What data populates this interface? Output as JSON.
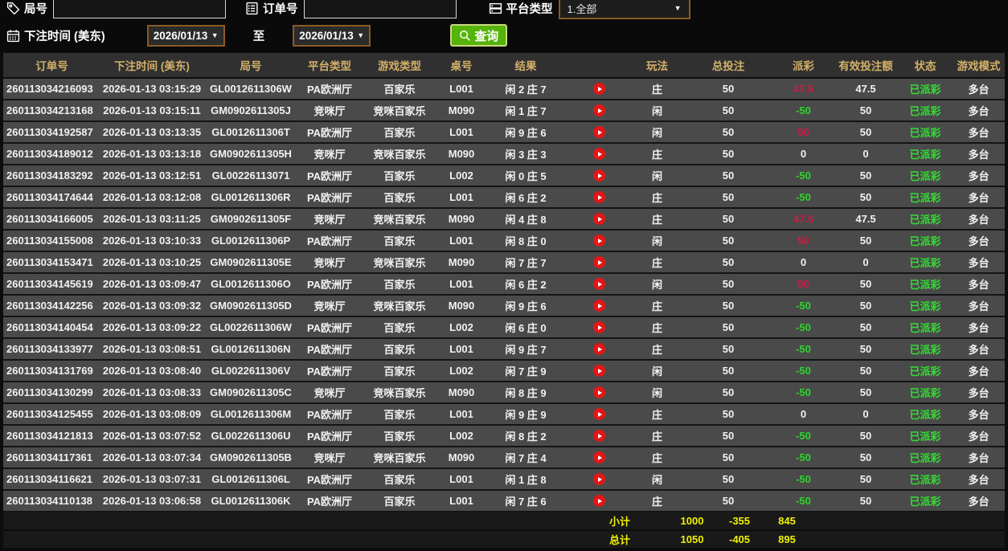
{
  "filters": {
    "game_no_label": "局号",
    "order_no_label": "订单号",
    "platform_label": "平台类型",
    "platform_value": "1.全部",
    "time_label": "下注时间 (美东)",
    "date_from": "2026/01/13",
    "date_to": "2026/01/13",
    "to_label": "至",
    "search_label": "查询"
  },
  "table": {
    "headers": [
      "订单号",
      "下注时间 (美东)",
      "局号",
      "平台类型",
      "游戏类型",
      "桌号",
      "结果",
      "玩法",
      "总投注",
      "派彩",
      "有效投注额",
      "状态",
      "游戏模式"
    ],
    "rows": [
      {
        "order": "260113034216093",
        "time": "2026-01-13 03:15:29",
        "game_no": "GL0012611306W",
        "platform": "PA欧洲厅",
        "game_type": "百家乐",
        "table_no": "L001",
        "result": "闲 2 庄 7",
        "bet": "庄",
        "total": "50",
        "payout": "47.5",
        "payout_class": "pos",
        "valid": "47.5",
        "status": "已派彩",
        "mode": "多台"
      },
      {
        "order": "260113034213168",
        "time": "2026-01-13 03:15:11",
        "game_no": "GM0902611305J",
        "platform": "竞咪厅",
        "game_type": "竞咪百家乐",
        "table_no": "M090",
        "result": "闲 1 庄 7",
        "bet": "闲",
        "total": "50",
        "payout": "-50",
        "payout_class": "neg",
        "valid": "50",
        "status": "已派彩",
        "mode": "多台"
      },
      {
        "order": "260113034192587",
        "time": "2026-01-13 03:13:35",
        "game_no": "GL0012611306T",
        "platform": "PA欧洲厅",
        "game_type": "百家乐",
        "table_no": "L001",
        "result": "闲 9 庄 6",
        "bet": "闲",
        "total": "50",
        "payout": "50",
        "payout_class": "pos",
        "valid": "50",
        "status": "已派彩",
        "mode": "多台"
      },
      {
        "order": "260113034189012",
        "time": "2026-01-13 03:13:18",
        "game_no": "GM0902611305H",
        "platform": "竞咪厅",
        "game_type": "竞咪百家乐",
        "table_no": "M090",
        "result": "闲 3 庄 3",
        "bet": "庄",
        "total": "50",
        "payout": "0",
        "payout_class": "zero",
        "valid": "0",
        "status": "已派彩",
        "mode": "多台"
      },
      {
        "order": "260113034183292",
        "time": "2026-01-13 03:12:51",
        "game_no": "GL00226113071",
        "platform": "PA欧洲厅",
        "game_type": "百家乐",
        "table_no": "L002",
        "result": "闲 0 庄 5",
        "bet": "闲",
        "total": "50",
        "payout": "-50",
        "payout_class": "neg",
        "valid": "50",
        "status": "已派彩",
        "mode": "多台"
      },
      {
        "order": "260113034174644",
        "time": "2026-01-13 03:12:08",
        "game_no": "GL0012611306R",
        "platform": "PA欧洲厅",
        "game_type": "百家乐",
        "table_no": "L001",
        "result": "闲 6 庄 2",
        "bet": "庄",
        "total": "50",
        "payout": "-50",
        "payout_class": "neg",
        "valid": "50",
        "status": "已派彩",
        "mode": "多台"
      },
      {
        "order": "260113034166005",
        "time": "2026-01-13 03:11:25",
        "game_no": "GM0902611305F",
        "platform": "竞咪厅",
        "game_type": "竞咪百家乐",
        "table_no": "M090",
        "result": "闲 4 庄 8",
        "bet": "庄",
        "total": "50",
        "payout": "47.5",
        "payout_class": "pos",
        "valid": "47.5",
        "status": "已派彩",
        "mode": "多台"
      },
      {
        "order": "260113034155008",
        "time": "2026-01-13 03:10:33",
        "game_no": "GL0012611306P",
        "platform": "PA欧洲厅",
        "game_type": "百家乐",
        "table_no": "L001",
        "result": "闲 8 庄 0",
        "bet": "闲",
        "total": "50",
        "payout": "50",
        "payout_class": "pos",
        "valid": "50",
        "status": "已派彩",
        "mode": "多台"
      },
      {
        "order": "260113034153471",
        "time": "2026-01-13 03:10:25",
        "game_no": "GM0902611305E",
        "platform": "竞咪厅",
        "game_type": "竞咪百家乐",
        "table_no": "M090",
        "result": "闲 7 庄 7",
        "bet": "庄",
        "total": "50",
        "payout": "0",
        "payout_class": "zero",
        "valid": "0",
        "status": "已派彩",
        "mode": "多台"
      },
      {
        "order": "260113034145619",
        "time": "2026-01-13 03:09:47",
        "game_no": "GL0012611306O",
        "platform": "PA欧洲厅",
        "game_type": "百家乐",
        "table_no": "L001",
        "result": "闲 6 庄 2",
        "bet": "闲",
        "total": "50",
        "payout": "50",
        "payout_class": "pos",
        "valid": "50",
        "status": "已派彩",
        "mode": "多台"
      },
      {
        "order": "260113034142256",
        "time": "2026-01-13 03:09:32",
        "game_no": "GM0902611305D",
        "platform": "竞咪厅",
        "game_type": "竞咪百家乐",
        "table_no": "M090",
        "result": "闲 9 庄 6",
        "bet": "庄",
        "total": "50",
        "payout": "-50",
        "payout_class": "neg",
        "valid": "50",
        "status": "已派彩",
        "mode": "多台"
      },
      {
        "order": "260113034140454",
        "time": "2026-01-13 03:09:22",
        "game_no": "GL0022611306W",
        "platform": "PA欧洲厅",
        "game_type": "百家乐",
        "table_no": "L002",
        "result": "闲 6 庄 0",
        "bet": "庄",
        "total": "50",
        "payout": "-50",
        "payout_class": "neg",
        "valid": "50",
        "status": "已派彩",
        "mode": "多台"
      },
      {
        "order": "260113034133977",
        "time": "2026-01-13 03:08:51",
        "game_no": "GL0012611306N",
        "platform": "PA欧洲厅",
        "game_type": "百家乐",
        "table_no": "L001",
        "result": "闲 9 庄 7",
        "bet": "庄",
        "total": "50",
        "payout": "-50",
        "payout_class": "neg",
        "valid": "50",
        "status": "已派彩",
        "mode": "多台"
      },
      {
        "order": "260113034131769",
        "time": "2026-01-13 03:08:40",
        "game_no": "GL0022611306V",
        "platform": "PA欧洲厅",
        "game_type": "百家乐",
        "table_no": "L002",
        "result": "闲 7 庄 9",
        "bet": "闲",
        "total": "50",
        "payout": "-50",
        "payout_class": "neg",
        "valid": "50",
        "status": "已派彩",
        "mode": "多台"
      },
      {
        "order": "260113034130299",
        "time": "2026-01-13 03:08:33",
        "game_no": "GM0902611305C",
        "platform": "竞咪厅",
        "game_type": "竞咪百家乐",
        "table_no": "M090",
        "result": "闲 8 庄 9",
        "bet": "闲",
        "total": "50",
        "payout": "-50",
        "payout_class": "neg",
        "valid": "50",
        "status": "已派彩",
        "mode": "多台"
      },
      {
        "order": "260113034125455",
        "time": "2026-01-13 03:08:09",
        "game_no": "GL0012611306M",
        "platform": "PA欧洲厅",
        "game_type": "百家乐",
        "table_no": "L001",
        "result": "闲 9 庄 9",
        "bet": "庄",
        "total": "50",
        "payout": "0",
        "payout_class": "zero",
        "valid": "0",
        "status": "已派彩",
        "mode": "多台"
      },
      {
        "order": "260113034121813",
        "time": "2026-01-13 03:07:52",
        "game_no": "GL0022611306U",
        "platform": "PA欧洲厅",
        "game_type": "百家乐",
        "table_no": "L002",
        "result": "闲 8 庄 2",
        "bet": "庄",
        "total": "50",
        "payout": "-50",
        "payout_class": "neg",
        "valid": "50",
        "status": "已派彩",
        "mode": "多台"
      },
      {
        "order": "260113034117361",
        "time": "2026-01-13 03:07:34",
        "game_no": "GM0902611305B",
        "platform": "竞咪厅",
        "game_type": "竞咪百家乐",
        "table_no": "M090",
        "result": "闲 7 庄 4",
        "bet": "庄",
        "total": "50",
        "payout": "-50",
        "payout_class": "neg",
        "valid": "50",
        "status": "已派彩",
        "mode": "多台"
      },
      {
        "order": "260113034116621",
        "time": "2026-01-13 03:07:31",
        "game_no": "GL0012611306L",
        "platform": "PA欧洲厅",
        "game_type": "百家乐",
        "table_no": "L001",
        "result": "闲 1 庄 8",
        "bet": "闲",
        "total": "50",
        "payout": "-50",
        "payout_class": "neg",
        "valid": "50",
        "status": "已派彩",
        "mode": "多台"
      },
      {
        "order": "260113034110138",
        "time": "2026-01-13 03:06:58",
        "game_no": "GL0012611306K",
        "platform": "PA欧洲厅",
        "game_type": "百家乐",
        "table_no": "L001",
        "result": "闲 7 庄 6",
        "bet": "庄",
        "total": "50",
        "payout": "-50",
        "payout_class": "neg",
        "valid": "50",
        "status": "已派彩",
        "mode": "多台"
      }
    ],
    "subtotal": {
      "label": "小计",
      "total_bet": "1000",
      "payout": "-355",
      "valid_bet": "845"
    },
    "grand_total": {
      "label": "总计",
      "total_bet": "1050",
      "payout": "-405",
      "valid_bet": "895"
    }
  },
  "colors": {
    "header_text": "#d3b06a",
    "payout_win": "#cb1b45",
    "payout_loss": "#2fd32f",
    "status_paid": "#33dd33",
    "summary_text": "#f0f000",
    "search_button": "#56b30b",
    "picker_border": "#8a5a26",
    "row_bg": "#4a4a4a",
    "replay_icon": "#e51616"
  }
}
